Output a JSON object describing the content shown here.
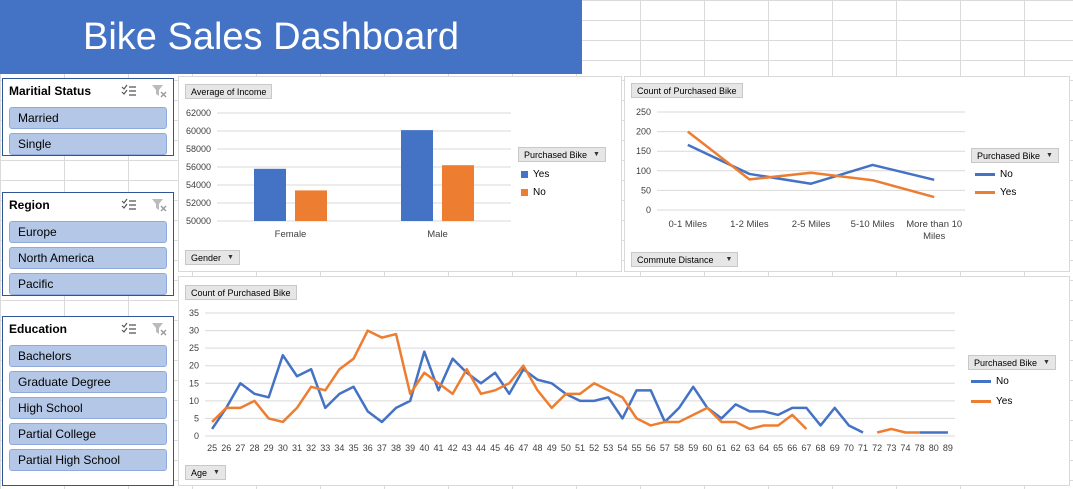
{
  "title": "Bike Sales Dashboard",
  "colors": {
    "yes_bar": "#4472c4",
    "no_bar": "#ed7d31",
    "no_line": "#4472c4",
    "yes_line": "#ed7d31",
    "slicer_fill": "#b4c7e7",
    "title_bg": "#4472c4"
  },
  "slicers": [
    {
      "title": "Maritial Status",
      "icons": [
        "multi-select-icon",
        "clear-filter-icon"
      ],
      "items": [
        "Married",
        "Single"
      ]
    },
    {
      "title": "Region",
      "icons": [
        "multi-select-icon",
        "clear-filter-icon"
      ],
      "items": [
        "Europe",
        "North America",
        "Pacific"
      ]
    },
    {
      "title": "Education",
      "icons": [
        "multi-select-icon",
        "clear-filter-icon"
      ],
      "items": [
        "Bachelors",
        "Graduate Degree",
        "High School",
        "Partial College",
        "Partial High School"
      ]
    }
  ],
  "chart_data": [
    {
      "type": "bar",
      "field_button": "Average of Income",
      "axis_button": "Gender",
      "legend_title": "Purchased Bike",
      "categories": [
        "Female",
        "Male"
      ],
      "series": [
        {
          "name": "Yes",
          "values": [
            55800,
            60100
          ]
        },
        {
          "name": "No",
          "values": [
            53400,
            56200
          ]
        }
      ],
      "ylim": [
        50000,
        62000
      ],
      "yticks": [
        50000,
        52000,
        54000,
        56000,
        58000,
        60000,
        62000
      ],
      "grid": true,
      "legend": "right"
    },
    {
      "type": "line",
      "field_button": "Count of Purchased Bike",
      "axis_button": "Commute Distance",
      "legend_title": "Purchased Bike",
      "categories": [
        "0-1 Miles",
        "1-2 Miles",
        "2-5 Miles",
        "5-10 Miles",
        "More than 10 Miles"
      ],
      "series": [
        {
          "name": "No",
          "values": [
            166,
            92,
            67,
            115,
            77
          ]
        },
        {
          "name": "Yes",
          "values": [
            200,
            78,
            95,
            76,
            33
          ]
        }
      ],
      "ylim": [
        0,
        250
      ],
      "yticks": [
        0,
        50,
        100,
        150,
        200,
        250
      ],
      "grid": true,
      "legend": "right"
    },
    {
      "type": "line",
      "field_button": "Count of Purchased Bike",
      "axis_button": "Age",
      "legend_title": "Purchased Bike",
      "categories": [
        25,
        26,
        27,
        28,
        29,
        30,
        31,
        32,
        33,
        34,
        35,
        36,
        37,
        38,
        39,
        40,
        41,
        42,
        43,
        44,
        45,
        46,
        47,
        48,
        49,
        50,
        51,
        52,
        53,
        54,
        55,
        56,
        57,
        58,
        59,
        60,
        61,
        62,
        63,
        64,
        65,
        66,
        67,
        68,
        69,
        70,
        71,
        72,
        73,
        74,
        78,
        80,
        89
      ],
      "series": [
        {
          "name": "No",
          "values": [
            2,
            8,
            15,
            12,
            11,
            23,
            17,
            19,
            8,
            12,
            14,
            7,
            4,
            8,
            10,
            24,
            13,
            22,
            18,
            15,
            18,
            12,
            19,
            16,
            15,
            12,
            10,
            10,
            11,
            5,
            13,
            13,
            4,
            8,
            14,
            8,
            5,
            9,
            7,
            7,
            6,
            8,
            8,
            3,
            8,
            3,
            1,
            null,
            null,
            null,
            1,
            1,
            1
          ]
        },
        {
          "name": "Yes",
          "values": [
            4,
            8,
            8,
            10,
            5,
            4,
            8,
            14,
            13,
            19,
            22,
            30,
            28,
            29,
            12,
            18,
            15,
            12,
            19,
            12,
            13,
            15,
            20,
            13,
            8,
            12,
            12,
            15,
            13,
            11,
            5,
            3,
            4,
            4,
            6,
            8,
            4,
            4,
            2,
            3,
            3,
            6,
            2,
            null,
            null,
            null,
            null,
            1,
            2,
            1,
            1,
            null,
            null
          ]
        }
      ],
      "ylim": [
        0,
        35
      ],
      "yticks": [
        0,
        5,
        10,
        15,
        20,
        25,
        30,
        35
      ],
      "grid": true,
      "legend": "right"
    }
  ]
}
